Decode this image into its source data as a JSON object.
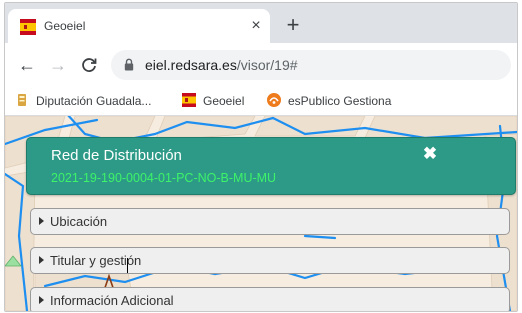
{
  "browser": {
    "tab": {
      "title": "Geoeiel",
      "favicon": "spain-flag-icon",
      "close_glyph": "×"
    },
    "new_tab_glyph": "+",
    "nav": {
      "back_glyph": "←",
      "forward_glyph": "→",
      "reload_glyph": "C"
    },
    "address": {
      "host": "eiel.redsara.es",
      "path": "/visor/19#"
    },
    "bookmarks": [
      {
        "label": "Diputación Guadala...",
        "icon": "bookmark-page-icon"
      },
      {
        "label": "Geoeiel",
        "icon": "spain-flag-icon"
      },
      {
        "label": "esPublico Gestiona",
        "icon": "espublico-icon"
      }
    ]
  },
  "panel": {
    "title": "Red de Distribución",
    "code": "2021-19-190-0004-01-PC-NO-B-MU-MU",
    "close_glyph": "✖",
    "sections": [
      {
        "label": "Ubicación"
      },
      {
        "label": "Titular y gestión"
      },
      {
        "label": "Información Adicional"
      }
    ]
  },
  "colors": {
    "panel_bg": "#2c9a86",
    "code_text": "#3ef26a",
    "map_bg": "#f6ecdf",
    "network_lines": "#1e8ff0"
  }
}
